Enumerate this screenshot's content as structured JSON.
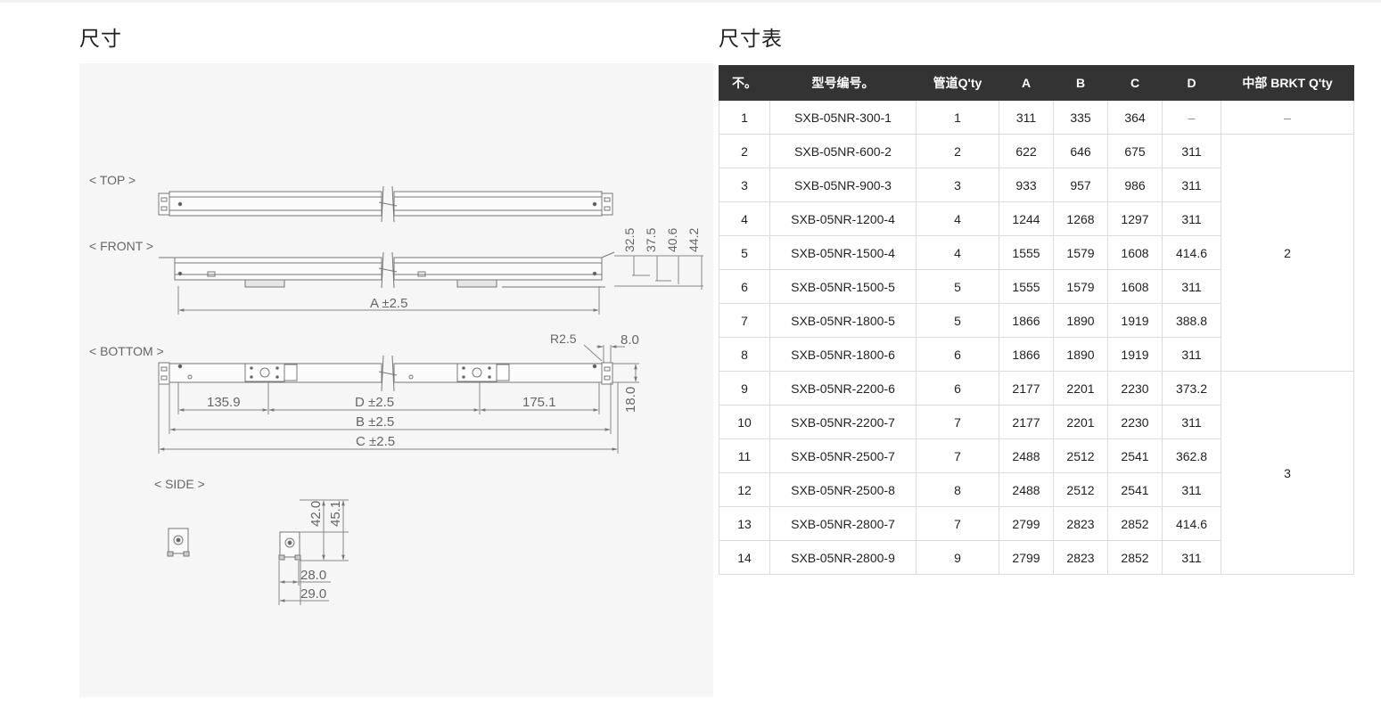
{
  "left_heading": "尺寸",
  "right_heading": "尺寸表",
  "drawing": {
    "top_label": "< TOP >",
    "front_label": "< FRONT >",
    "bottom_label": "< BOTTOM >",
    "side_label": "< SIDE >",
    "dims": {
      "a": "A ±2.5",
      "b": "B ±2.5",
      "c": "C ±2.5",
      "d": "D ±2.5",
      "left_offset": "135.9",
      "right_offset": "175.1",
      "r": "R2.5",
      "w8": "8.0",
      "h18": "18.0",
      "h325": "32.5",
      "h375": "37.5",
      "h406": "40.6",
      "h442": "44.2",
      "h420": "42.0",
      "h451": "45.1",
      "w280": "28.0",
      "w290": "29.0"
    }
  },
  "table": {
    "headers": [
      "不。",
      "型号编号。",
      "管道Q'ty",
      "A",
      "B",
      "C",
      "D",
      "中部 BRKT Q'ty"
    ],
    "rows": [
      [
        "1",
        "SXB-05NR-300-1",
        "1",
        "311",
        "335",
        "364",
        "–"
      ],
      [
        "2",
        "SXB-05NR-600-2",
        "2",
        "622",
        "646",
        "675",
        "311"
      ],
      [
        "3",
        "SXB-05NR-900-3",
        "3",
        "933",
        "957",
        "986",
        "311"
      ],
      [
        "4",
        "SXB-05NR-1200-4",
        "4",
        "1244",
        "1268",
        "1297",
        "311"
      ],
      [
        "5",
        "SXB-05NR-1500-4",
        "4",
        "1555",
        "1579",
        "1608",
        "414.6"
      ],
      [
        "6",
        "SXB-05NR-1500-5",
        "5",
        "1555",
        "1579",
        "1608",
        "311"
      ],
      [
        "7",
        "SXB-05NR-1800-5",
        "5",
        "1866",
        "1890",
        "1919",
        "388.8"
      ],
      [
        "8",
        "SXB-05NR-1800-6",
        "6",
        "1866",
        "1890",
        "1919",
        "311"
      ],
      [
        "9",
        "SXB-05NR-2200-6",
        "6",
        "2177",
        "2201",
        "2230",
        "373.2"
      ],
      [
        "10",
        "SXB-05NR-2200-7",
        "7",
        "2177",
        "2201",
        "2230",
        "311"
      ],
      [
        "11",
        "SXB-05NR-2500-7",
        "7",
        "2488",
        "2512",
        "2541",
        "362.8"
      ],
      [
        "12",
        "SXB-05NR-2500-8",
        "8",
        "2488",
        "2512",
        "2541",
        "311"
      ],
      [
        "13",
        "SXB-05NR-2800-7",
        "7",
        "2799",
        "2823",
        "2852",
        "414.6"
      ],
      [
        "14",
        "SXB-05NR-2800-9",
        "9",
        "2799",
        "2823",
        "2852",
        "311"
      ]
    ],
    "brkt_groups": [
      {
        "value": "–",
        "rows": 1
      },
      {
        "value": "2",
        "rows": 7
      },
      {
        "value": "3",
        "rows": 6
      }
    ]
  }
}
